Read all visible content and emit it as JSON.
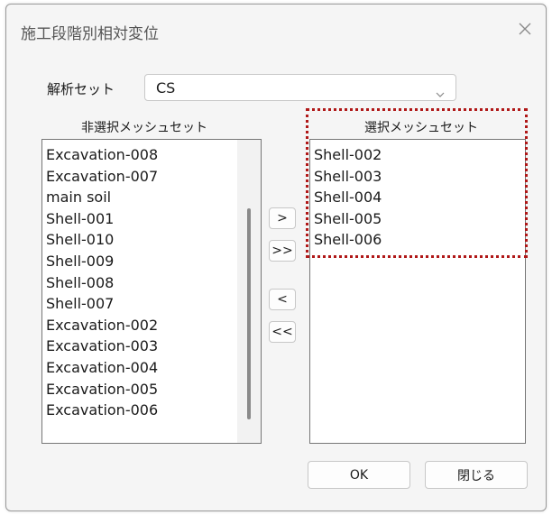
{
  "window": {
    "title": "施工段階別相対変位",
    "close_icon": "close-icon"
  },
  "analysis_set": {
    "label": "解析セット",
    "value": "CS"
  },
  "unselected": {
    "header": "非選択メッシュセット",
    "items": [
      "Excavation-008",
      "Excavation-007",
      "main soil",
      "Shell-001",
      "Shell-010",
      "Shell-009",
      "Shell-008",
      "Shell-007",
      "Excavation-002",
      "Excavation-003",
      "Excavation-004",
      "Excavation-005",
      "Excavation-006"
    ]
  },
  "selected": {
    "header": "選択メッシュセット",
    "items": [
      "Shell-002",
      "Shell-003",
      "Shell-004",
      "Shell-005",
      "Shell-006"
    ]
  },
  "transfer": {
    "add": ">",
    "add_all": ">>",
    "remove": "<",
    "remove_all": "<<"
  },
  "footer": {
    "ok": "OK",
    "close": "閉じる"
  },
  "colors": {
    "highlight": "#b01818"
  }
}
